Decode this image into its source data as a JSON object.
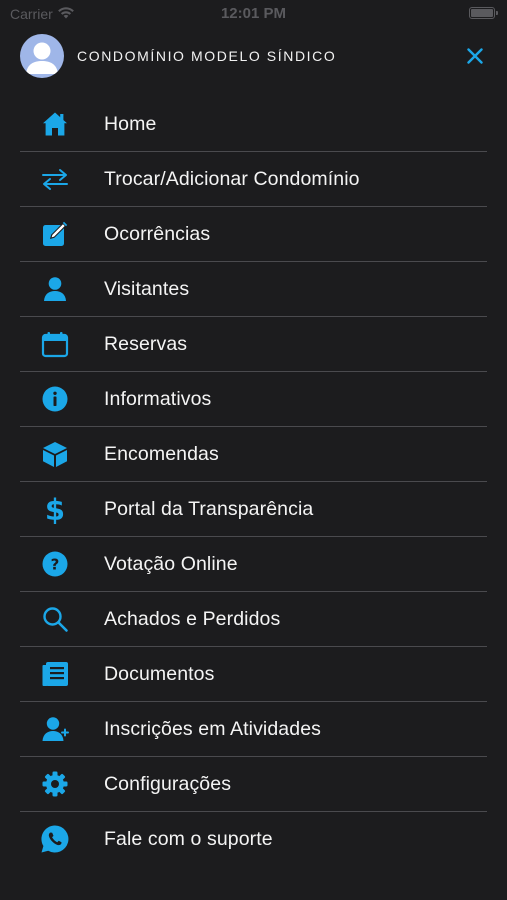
{
  "status_bar": {
    "carrier": "Carrier",
    "time": "12:01 PM"
  },
  "header": {
    "title": "CONDOMÍNIO MODELO SÍNDICO"
  },
  "colors": {
    "accent": "#1ba7e8",
    "background": "#1c1c1e",
    "divider": "#4a4a4e",
    "avatar": "#9fb6e8"
  },
  "menu": {
    "items": [
      {
        "label": "Home",
        "icon": "home-icon"
      },
      {
        "label": "Trocar/Adicionar Condomínio",
        "icon": "swap-arrows-icon"
      },
      {
        "label": "Ocorrências",
        "icon": "edit-note-icon"
      },
      {
        "label": "Visitantes",
        "icon": "person-icon"
      },
      {
        "label": "Reservas",
        "icon": "calendar-icon"
      },
      {
        "label": "Informativos",
        "icon": "info-icon"
      },
      {
        "label": "Encomendas",
        "icon": "package-box-icon"
      },
      {
        "label": "Portal da Transparência",
        "icon": "dollar-icon"
      },
      {
        "label": "Votação Online",
        "icon": "question-icon"
      },
      {
        "label": "Achados e Perdidos",
        "icon": "search-icon"
      },
      {
        "label": "Documentos",
        "icon": "document-list-icon"
      },
      {
        "label": "Inscrições em Atividades",
        "icon": "person-add-icon"
      },
      {
        "label": "Configurações",
        "icon": "gear-icon"
      },
      {
        "label": "Fale com o suporte",
        "icon": "whatsapp-icon"
      }
    ]
  }
}
